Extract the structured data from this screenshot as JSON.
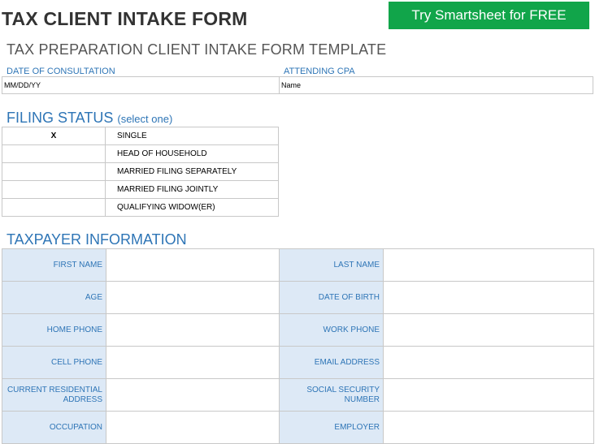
{
  "header": {
    "title": "TAX CLIENT INTAKE FORM",
    "cta_label": "Try Smartsheet for FREE",
    "subtitle": "TAX PREPARATION CLIENT INTAKE FORM TEMPLATE"
  },
  "consultation": {
    "date_label": "DATE OF CONSULTATION",
    "cpa_label": "ATTENDING CPA",
    "date_value": "MM/DD/YY",
    "cpa_value": "Name"
  },
  "filing_status": {
    "title": "FILING STATUS",
    "hint": "(select one)",
    "options": [
      {
        "mark": "X",
        "label": "SINGLE"
      },
      {
        "mark": "",
        "label": "HEAD OF HOUSEHOLD"
      },
      {
        "mark": "",
        "label": "MARRIED FILING SEPARATELY"
      },
      {
        "mark": "",
        "label": "MARRIED FILING JOINTLY"
      },
      {
        "mark": "",
        "label": "QUALIFYING WIDOW(ER)"
      }
    ]
  },
  "taxpayer": {
    "title": "TAXPAYER INFORMATION",
    "rows": [
      {
        "left": "FIRST NAME",
        "right": "LAST NAME"
      },
      {
        "left": "AGE",
        "right": "DATE OF BIRTH"
      },
      {
        "left": "HOME PHONE",
        "right": "WORK PHONE"
      },
      {
        "left": "CELL PHONE",
        "right": "EMAIL ADDRESS"
      },
      {
        "left": "CURRENT RESIDENTIAL ADDRESS",
        "right": "SOCIAL SECURITY NUMBER"
      },
      {
        "left": "OCCUPATION",
        "right": "EMPLOYER"
      }
    ]
  },
  "colors": {
    "accent_blue": "#2e75b6",
    "label_fill": "#dde9f6",
    "cta_green": "#11a54a"
  }
}
